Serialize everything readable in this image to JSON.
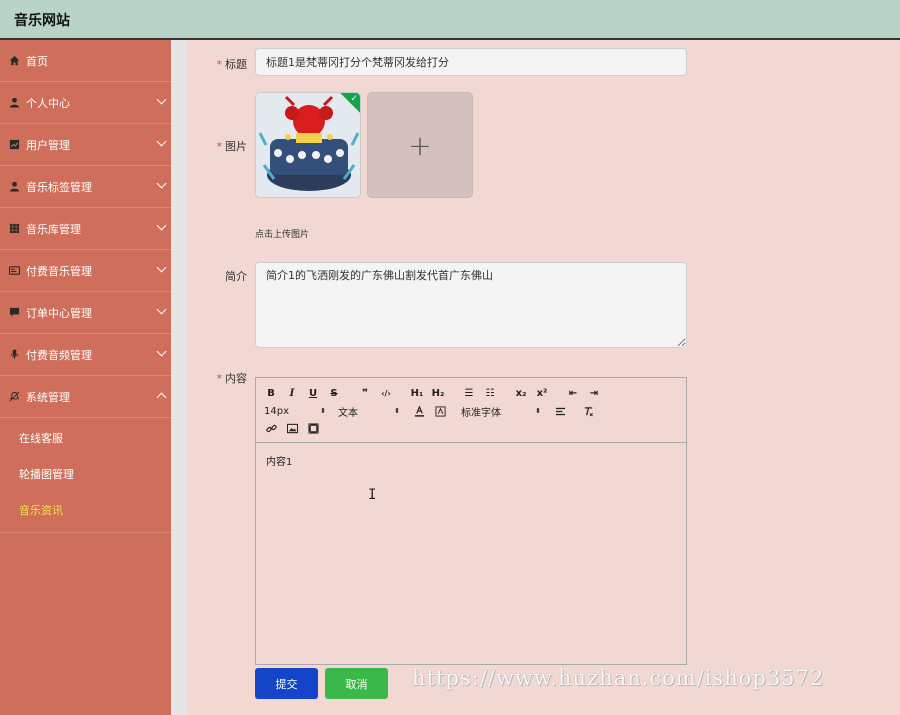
{
  "app": {
    "title": "音乐网站"
  },
  "sidebar": {
    "items": [
      {
        "label": "首页",
        "icon": "home-icon"
      },
      {
        "label": "个人中心",
        "icon": "user-icon"
      },
      {
        "label": "用户管理",
        "icon": "chart-icon"
      },
      {
        "label": "音乐标签管理",
        "icon": "user-icon"
      },
      {
        "label": "音乐库管理",
        "icon": "grid-icon"
      },
      {
        "label": "付费音乐管理",
        "icon": "card-icon"
      },
      {
        "label": "订单中心管理",
        "icon": "comment-icon"
      },
      {
        "label": "付费音频管理",
        "icon": "mic-icon"
      },
      {
        "label": "系统管理",
        "icon": "bell-off-icon"
      }
    ],
    "sub_items": [
      {
        "label": "在线客服"
      },
      {
        "label": "轮播图管理"
      },
      {
        "label": "音乐资讯"
      }
    ]
  },
  "form": {
    "title_label": "标题",
    "title_value": "标题1是梵蒂冈打分个梵蒂冈发给打分",
    "image_label": "图片",
    "upload_hint": "点击上传图片",
    "desc_label": "简介",
    "desc_value": "简介1的飞洒刚发的广东佛山割发代首广东佛山",
    "content_label": "内容",
    "content_value": "内容1"
  },
  "editor": {
    "row1": [
      "B",
      "I",
      "U",
      "S",
      "❞",
      "‹/›",
      "H₁",
      "H₂",
      "☰",
      "☷",
      "x₂",
      "x²",
      "⇤",
      "⇥"
    ],
    "font_size": "14px",
    "block_type": "文本",
    "font_family": "标准字体",
    "arrow_glyph": "⬍"
  },
  "buttons": {
    "submit": "提交",
    "cancel": "取消"
  },
  "watermark": "https://www.huzhan.com/ishop3572",
  "colors": {
    "header": "#b9d4c6",
    "sidebar": "#cf6e5a",
    "active_sub": "#f3e24c",
    "submit": "#1444c8",
    "cancel": "#3cb84a"
  }
}
